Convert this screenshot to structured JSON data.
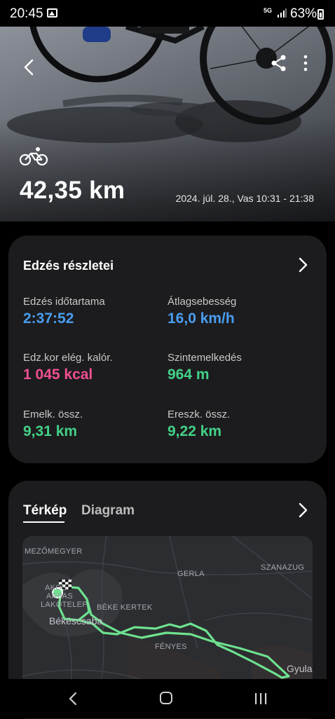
{
  "status_bar": {
    "time": "20:45",
    "network": "5G",
    "battery_percent": "63%",
    "icons": [
      "gallery-icon",
      "signal-icon",
      "battery-icon"
    ]
  },
  "hero": {
    "activity_icon": "bicycle-icon",
    "distance": "42,35 km",
    "date_time": "2024. júl. 28., Vas 10:31 - 21:38",
    "actions": [
      "back-icon",
      "share-icon",
      "more-icon"
    ]
  },
  "details": {
    "title": "Edzés részletei",
    "stats": [
      {
        "label": "Edzés időtartama",
        "value": "2:37:52",
        "color": "#4a9df0"
      },
      {
        "label": "Átlagsebesség",
        "value": "16,0 km/h",
        "color": "#4a9df0"
      },
      {
        "label": "Edz.kor elég. kalór.",
        "value": "1 045 kcal",
        "color": "#ef4f91"
      },
      {
        "label": "Szintemelkedés",
        "value": "964 m",
        "color": "#43d187"
      },
      {
        "label": "Emelk. össz.",
        "value": "9,31 km",
        "color": "#43d187"
      },
      {
        "label": "Ereszk. össz.",
        "value": "9,22 km",
        "color": "#43d187"
      }
    ]
  },
  "map_card": {
    "tabs": [
      {
        "label": "Térkép",
        "active": true
      },
      {
        "label": "Diagram",
        "active": false
      }
    ],
    "route_color": "#6ee18f",
    "places": [
      "MEZŐMEGYER",
      "AKOS",
      "ARPAS",
      "LAKÓTELEP",
      "BÉKE KERTEK",
      "Békéscsaba",
      "GERLA",
      "SZANAZUG",
      "FÉNYES",
      "Gyula"
    ]
  },
  "nav_bar": {
    "buttons": [
      "back-icon",
      "home-icon",
      "recents-icon"
    ]
  }
}
